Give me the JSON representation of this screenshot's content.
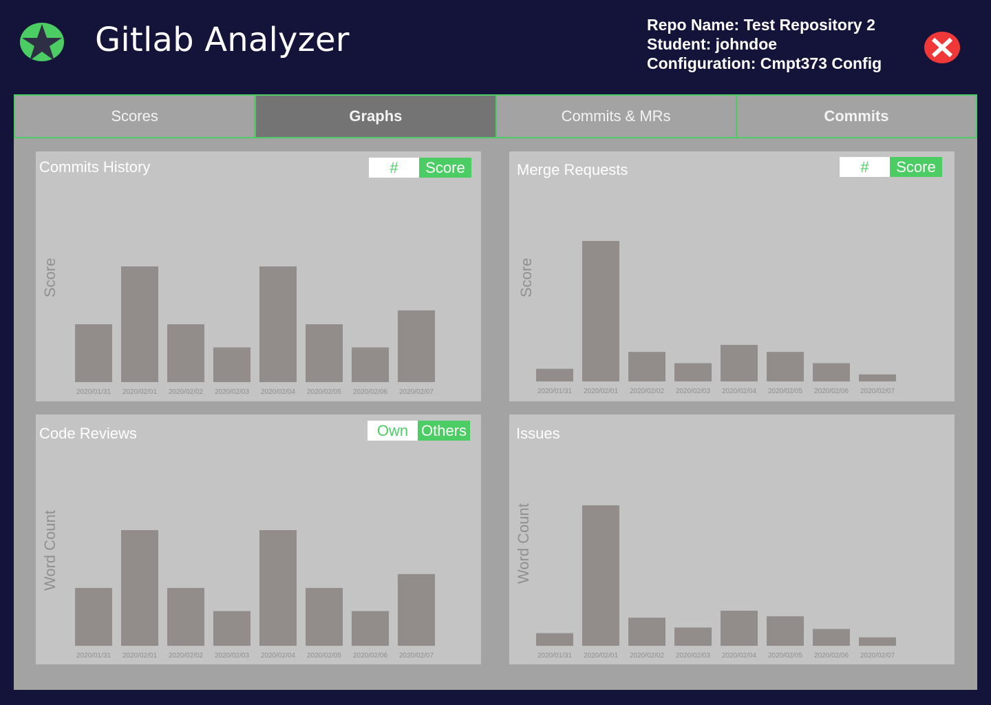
{
  "header": {
    "app_title": "Gitlab Analyzer",
    "logo_icon": "star-icon",
    "repo_line": "Repo Name: Test Repository 2",
    "student_line": "Student: johndoe",
    "config_line": "Configuration: Cmpt373 Config",
    "close_icon": "close-icon"
  },
  "colors": {
    "accent": "#4ccd64",
    "header_bg": "#14143a",
    "close": "#f03838",
    "bar": "#928c8b"
  },
  "tabs": [
    {
      "label": "Scores",
      "active": false
    },
    {
      "label": "Graphs",
      "active": true
    },
    {
      "label": "Commits & MRs",
      "active": false
    },
    {
      "label": "Commits",
      "active": false
    }
  ],
  "panels": {
    "commits": {
      "title": "Commits History",
      "toggle": [
        "#",
        "Score"
      ],
      "toggle_selected": "Score"
    },
    "merge_requests": {
      "title": "Merge Requests",
      "toggle": [
        "#",
        "Score"
      ],
      "toggle_selected": "Score"
    },
    "code_reviews": {
      "title": "Code Reviews",
      "toggle": [
        "Own",
        "Others"
      ],
      "toggle_selected": "Others"
    },
    "issues": {
      "title": "Issues"
    }
  },
  "chart_data": [
    {
      "type": "bar",
      "title": "Commits History",
      "xlabel": "",
      "ylabel": "Score",
      "categories": [
        "2020/01/31",
        "2020/02/01",
        "2020/02/02",
        "2020/02/03",
        "2020/02/04",
        "2020/02/05",
        "2020/02/06",
        "2020/02/07"
      ],
      "values": [
        5,
        10,
        5,
        3,
        10,
        5,
        3,
        6.2
      ],
      "ylim": [
        0,
        10
      ]
    },
    {
      "type": "bar",
      "title": "Merge Requests",
      "xlabel": "",
      "ylabel": "Score",
      "categories": [
        "2020/01/31",
        "2020/02/01",
        "2020/02/02",
        "2020/02/03",
        "2020/02/04",
        "2020/02/05",
        "2020/02/06",
        "2020/02/07"
      ],
      "values": [
        0.9,
        10,
        2.1,
        1.3,
        2.6,
        2.1,
        1.3,
        0.5
      ],
      "ylim": [
        0,
        10
      ]
    },
    {
      "type": "bar",
      "title": "Code Reviews",
      "xlabel": "",
      "ylabel": "Word Count",
      "categories": [
        "2020/01/31",
        "2020/02/01",
        "2020/02/02",
        "2020/02/03",
        "2020/02/04",
        "2020/02/05",
        "2020/02/06",
        "2020/02/07"
      ],
      "values": [
        5,
        10,
        5,
        3,
        10,
        5,
        3,
        6.2
      ],
      "ylim": [
        0,
        10
      ]
    },
    {
      "type": "bar",
      "title": "Issues",
      "xlabel": "",
      "ylabel": "Word Count",
      "categories": [
        "2020/01/31",
        "2020/02/01",
        "2020/02/02",
        "2020/02/03",
        "2020/02/04",
        "2020/02/05",
        "2020/02/06",
        "2020/02/07"
      ],
      "values": [
        0.9,
        10,
        2.0,
        1.3,
        2.5,
        2.1,
        1.2,
        0.6
      ],
      "ylim": [
        0,
        10
      ]
    }
  ]
}
